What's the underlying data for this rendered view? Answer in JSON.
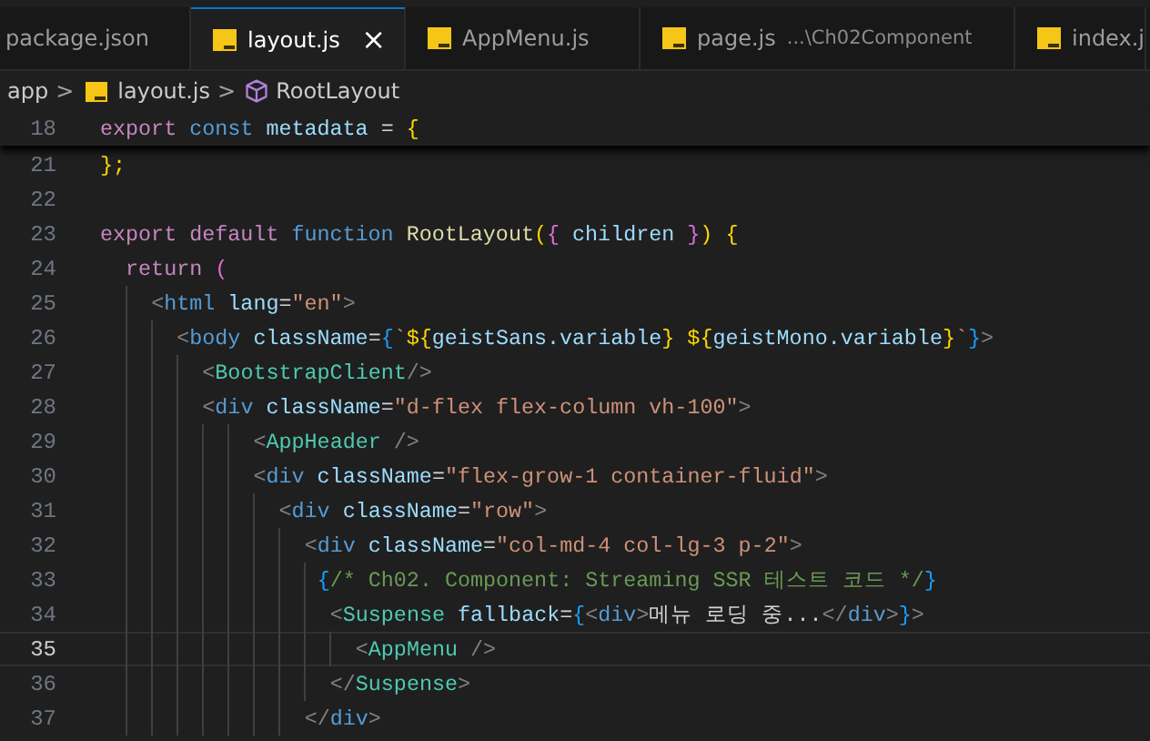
{
  "tabs": [
    {
      "label": "package.json",
      "selected": false,
      "icon": false
    },
    {
      "label": "layout.js",
      "selected": true,
      "icon": true,
      "close": "×"
    },
    {
      "label": "AppMenu.js",
      "selected": false,
      "icon": true
    },
    {
      "label": "page.js",
      "selected": false,
      "icon": true,
      "description": "...\\Ch02Component"
    },
    {
      "label": "index.j",
      "selected": false,
      "icon": true
    }
  ],
  "breadcrumb": {
    "folder": "app",
    "separator_1": ">",
    "file": "layout.js",
    "separator_2": ">",
    "symbol": "RootLayout"
  },
  "sticky_line": {
    "number": "18",
    "tokens": [
      {
        "text": "export",
        "kind": "kw"
      },
      {
        "text": " const",
        "kind": "st"
      },
      {
        "text": " metadata",
        "kind": "var"
      },
      {
        "text": " = ",
        "kind": "p"
      },
      {
        "text": "{",
        "kind": "br1"
      }
    ]
  },
  "lines": [
    {
      "number": "21",
      "current": false,
      "tokens": [
        {
          "text": "};",
          "kind": "br1"
        }
      ]
    },
    {
      "number": "22",
      "current": false
    },
    {
      "number": "23",
      "current": false,
      "tokens": [
        {
          "text": "export default",
          "kind": "kw"
        },
        {
          "text": " function",
          "kind": "st"
        },
        {
          "text": " RootLayout",
          "kind": "fn"
        },
        {
          "text": "(",
          "kind": "br1"
        },
        {
          "text": "{",
          "kind": "br2"
        },
        {
          "text": " children ",
          "kind": "var"
        },
        {
          "text": "}",
          "kind": "br2"
        },
        {
          "text": ")",
          "kind": "br1"
        },
        {
          "text": " {",
          "kind": "br1"
        }
      ]
    },
    {
      "number": "24",
      "current": false,
      "tokens": [
        {
          "text": "  return",
          "kind": "kw"
        },
        {
          "text": " (",
          "kind": "br2"
        }
      ]
    },
    {
      "number": "25",
      "current": false,
      "tokens": [
        {
          "text": "    <",
          "kind": "tag"
        },
        {
          "text": "html",
          "kind": "st"
        },
        {
          "text": " lang",
          "kind": "var"
        },
        {
          "text": "=",
          "kind": "p"
        },
        {
          "text": "\"en\"",
          "kind": "str"
        },
        {
          "text": ">",
          "kind": "tag"
        }
      ]
    },
    {
      "number": "26",
      "current": false,
      "tokens": [
        {
          "text": "      <",
          "kind": "tag"
        },
        {
          "text": "body",
          "kind": "st"
        },
        {
          "text": " className",
          "kind": "var"
        },
        {
          "text": "=",
          "kind": "p"
        },
        {
          "text": "{",
          "kind": "br3"
        },
        {
          "text": "`",
          "kind": "str"
        },
        {
          "text": "${",
          "kind": "br1"
        },
        {
          "text": "geistSans.variable",
          "kind": "var"
        },
        {
          "text": "}",
          "kind": "br1"
        },
        {
          "text": " ${",
          "kind": "br1"
        },
        {
          "text": "geistMono.variable",
          "kind": "var"
        },
        {
          "text": "}",
          "kind": "br1"
        },
        {
          "text": "`",
          "kind": "str"
        },
        {
          "text": "}",
          "kind": "br3"
        },
        {
          "text": ">",
          "kind": "tag"
        }
      ]
    },
    {
      "number": "27",
      "current": false,
      "tokens": [
        {
          "text": "        <",
          "kind": "tag"
        },
        {
          "text": "BootstrapClient",
          "kind": "comp"
        },
        {
          "text": "/>",
          "kind": "tag"
        }
      ]
    },
    {
      "number": "28",
      "current": false,
      "tokens": [
        {
          "text": "        <",
          "kind": "tag"
        },
        {
          "text": "div",
          "kind": "st"
        },
        {
          "text": " className",
          "kind": "var"
        },
        {
          "text": "=",
          "kind": "p"
        },
        {
          "text": "\"d-flex flex-column vh-100\"",
          "kind": "str"
        },
        {
          "text": ">",
          "kind": "tag"
        }
      ]
    },
    {
      "number": "29",
      "current": false,
      "tokens": [
        {
          "text": "            <",
          "kind": "tag"
        },
        {
          "text": "AppHeader",
          "kind": "comp"
        },
        {
          "text": " />",
          "kind": "tag"
        }
      ]
    },
    {
      "number": "30",
      "current": false,
      "tokens": [
        {
          "text": "            <",
          "kind": "tag"
        },
        {
          "text": "div",
          "kind": "st"
        },
        {
          "text": " className",
          "kind": "var"
        },
        {
          "text": "=",
          "kind": "p"
        },
        {
          "text": "\"flex-grow-1 container-fluid\"",
          "kind": "str"
        },
        {
          "text": ">",
          "kind": "tag"
        }
      ]
    },
    {
      "number": "31",
      "current": false,
      "tokens": [
        {
          "text": "              <",
          "kind": "tag"
        },
        {
          "text": "div",
          "kind": "st"
        },
        {
          "text": " className",
          "kind": "var"
        },
        {
          "text": "=",
          "kind": "p"
        },
        {
          "text": "\"row\"",
          "kind": "str"
        },
        {
          "text": ">",
          "kind": "tag"
        }
      ]
    },
    {
      "number": "32",
      "current": false,
      "tokens": [
        {
          "text": "                <",
          "kind": "tag"
        },
        {
          "text": "div",
          "kind": "st"
        },
        {
          "text": " className",
          "kind": "var"
        },
        {
          "text": "=",
          "kind": "p"
        },
        {
          "text": "\"col-md-4 col-lg-3 p-2\"",
          "kind": "str"
        },
        {
          "text": ">",
          "kind": "tag"
        }
      ]
    },
    {
      "number": "33",
      "current": false,
      "tokens": [
        {
          "text": "                 {",
          "kind": "br3"
        },
        {
          "text": "/* Ch02. Component: Streaming SSR 테스트 코드 */",
          "kind": "cmt"
        },
        {
          "text": "}",
          "kind": "br3"
        }
      ]
    },
    {
      "number": "34",
      "current": false,
      "tokens": [
        {
          "text": "                  <",
          "kind": "tag"
        },
        {
          "text": "Suspense",
          "kind": "comp"
        },
        {
          "text": " fallback",
          "kind": "var"
        },
        {
          "text": "=",
          "kind": "p"
        },
        {
          "text": "{",
          "kind": "br3"
        },
        {
          "text": "<",
          "kind": "tag"
        },
        {
          "text": "div",
          "kind": "st"
        },
        {
          "text": ">",
          "kind": "tag"
        },
        {
          "text": "메뉴 로딩 중...",
          "kind": "p"
        },
        {
          "text": "</",
          "kind": "tag"
        },
        {
          "text": "div",
          "kind": "st"
        },
        {
          "text": ">",
          "kind": "tag"
        },
        {
          "text": "}",
          "kind": "br3"
        },
        {
          "text": ">",
          "kind": "tag"
        }
      ]
    },
    {
      "number": "35",
      "current": true,
      "tokens": [
        {
          "text": "                    <",
          "kind": "tag"
        },
        {
          "text": "AppMenu",
          "kind": "comp"
        },
        {
          "text": " />",
          "kind": "tag"
        }
      ]
    },
    {
      "number": "36",
      "current": false,
      "tokens": [
        {
          "text": "                  </",
          "kind": "tag"
        },
        {
          "text": "Suspense",
          "kind": "comp"
        },
        {
          "text": ">",
          "kind": "tag"
        }
      ]
    },
    {
      "number": "37",
      "current": false,
      "tokens": [
        {
          "text": "                </",
          "kind": "tag"
        },
        {
          "text": "div",
          "kind": "st"
        },
        {
          "text": ">",
          "kind": "tag"
        }
      ]
    }
  ]
}
